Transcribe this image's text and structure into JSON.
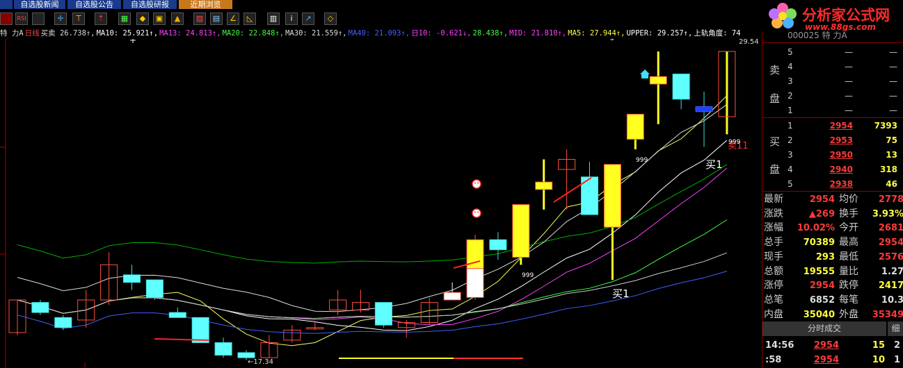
{
  "tabs": [
    "",
    "自选股新闻",
    "自选股公告",
    "自选股研报",
    "近期浏览"
  ],
  "indicator_bar": [
    {
      "text": "特  力A",
      "color": "#dddddd"
    },
    {
      "text": "日线",
      "color": "#ff4040"
    },
    {
      "text": "买卖 26.738↑,",
      "color": "#dddddd"
    },
    {
      "text": "MA10: 25.921↑,",
      "color": "#ffffff"
    },
    {
      "text": "MA13: 24.813↑,",
      "color": "#ff40ff"
    },
    {
      "text": "MA20: 22.848↑,",
      "color": "#40ff40"
    },
    {
      "text": "MA30: 21.559↑,",
      "color": "#dddddd"
    },
    {
      "text": "MA40: 21.093↑,",
      "color": "#4060ff"
    },
    {
      "text": "日10: -0.621↓,",
      "color": "#ff40ff"
    },
    {
      "text": "28.438↑,",
      "color": "#40ff40"
    },
    {
      "text": "MID: 21.810↑,",
      "color": "#ff40ff"
    },
    {
      "text": "MA5: 27.944↑,",
      "color": "#ffff40"
    },
    {
      "text": "UPPER: 29.257↑,",
      "color": "#ffffff"
    },
    {
      "text": "上轨角度: 74",
      "color": "#ffffff"
    }
  ],
  "chart_labels": {
    "top_right_price": "29.54",
    "low_price": "17.34",
    "buy1_a": "买1",
    "buy1_b": "买1",
    "sell11": "卖11",
    "n999_a": "999",
    "n999_b": "999",
    "n999_c": "999"
  },
  "logo": {
    "text": "分析家公式网",
    "url": "www.88gs.com"
  },
  "stock_code": "000025 特   力A",
  "sell_side_label": [
    "卖",
    "盘"
  ],
  "buy_side_label": [
    "买",
    "盘"
  ],
  "sell_orders": [
    {
      "level": "5",
      "price": "—",
      "volume": "—"
    },
    {
      "level": "4",
      "price": "—",
      "volume": "—"
    },
    {
      "level": "3",
      "price": "—",
      "volume": "—"
    },
    {
      "level": "2",
      "price": "—",
      "volume": "—"
    },
    {
      "level": "1",
      "price": "—",
      "volume": "—"
    }
  ],
  "buy_orders": [
    {
      "level": "1",
      "price": "2954",
      "volume": "7393"
    },
    {
      "level": "2",
      "price": "2953",
      "volume": "75"
    },
    {
      "level": "3",
      "price": "2950",
      "volume": "13"
    },
    {
      "level": "4",
      "price": "2940",
      "volume": "318"
    },
    {
      "level": "5",
      "price": "2938",
      "volume": "46"
    }
  ],
  "stats": [
    {
      "l1": "最新",
      "v1": "2954",
      "c1": "r",
      "l2": "均价",
      "v2": "2778",
      "c2": "r"
    },
    {
      "l1": "涨跌",
      "v1": "▲269",
      "c1": "r",
      "l2": "换手",
      "v2": "3.93%",
      "c2": "y"
    },
    {
      "l1": "涨幅",
      "v1": "10.02%",
      "c1": "r",
      "l2": "今开",
      "v2": "2681",
      "c2": "r"
    },
    {
      "l1": "总手",
      "v1": "70389",
      "c1": "y",
      "l2": "最高",
      "v2": "2954",
      "c2": "r"
    },
    {
      "l1": "现手",
      "v1": "293",
      "c1": "y",
      "l2": "最低",
      "v2": "2576",
      "c2": "r"
    },
    {
      "l1": "总额",
      "v1": "19555",
      "c1": "y",
      "l2": "量比",
      "v2": "1.27",
      "c2": "w"
    },
    {
      "l1": "涨停",
      "v1": "2954",
      "c1": "r",
      "l2": "跌停",
      "v2": "2417",
      "c2": "y"
    },
    {
      "l1": "总笔",
      "v1": "6852",
      "c1": "w",
      "l2": "每笔",
      "v2": "10.3",
      "c2": "w"
    },
    {
      "l1": "内盘",
      "v1": "35040",
      "c1": "y",
      "l2": "外盘",
      "v2": "35349",
      "c2": "r"
    }
  ],
  "tick_tab": "分时成交",
  "tick_tab2": "细",
  "ticks": [
    {
      "time": "14:56",
      "price": "2954",
      "vol": "15",
      "n": "2"
    },
    {
      "time": ":58",
      "price": "2954",
      "vol": "10",
      "n": "1"
    }
  ],
  "chart_data": {
    "type": "candlestick",
    "y_axis_price_range": [
      17.0,
      30.0
    ],
    "candles": [
      {
        "o": 18.3,
        "c": 19.6,
        "h": 19.6,
        "l": 18.2,
        "kind": "hollow"
      },
      {
        "o": 19.5,
        "c": 19.1,
        "h": 19.6,
        "l": 19.0,
        "kind": "cyan"
      },
      {
        "o": 18.9,
        "c": 18.5,
        "h": 19.0,
        "l": 18.4,
        "kind": "cyan"
      },
      {
        "o": 18.8,
        "c": 19.6,
        "h": 20.0,
        "l": 18.5,
        "kind": "hollow"
      },
      {
        "o": 19.6,
        "c": 21.0,
        "h": 21.5,
        "l": 19.4,
        "kind": "hollow"
      },
      {
        "o": 20.6,
        "c": 20.3,
        "h": 21.0,
        "l": 20.0,
        "kind": "cyan"
      },
      {
        "o": 20.4,
        "c": 19.7,
        "h": 20.4,
        "l": 19.6,
        "kind": "cyan"
      },
      {
        "o": 19.1,
        "c": 18.9,
        "h": 19.3,
        "l": 18.9,
        "kind": "cyan"
      },
      {
        "o": 18.9,
        "c": 17.9,
        "h": 18.9,
        "l": 17.9,
        "kind": "cyan"
      },
      {
        "o": 17.9,
        "c": 17.4,
        "h": 18.1,
        "l": 17.3,
        "kind": "cyan"
      },
      {
        "o": 17.5,
        "c": 17.3,
        "h": 17.6,
        "l": 17.2,
        "kind": "cyan"
      },
      {
        "o": 17.3,
        "c": 17.9,
        "h": 18.2,
        "l": 17.3,
        "kind": "hollow"
      },
      {
        "o": 18.0,
        "c": 18.4,
        "h": 18.6,
        "l": 17.9,
        "kind": "hollow"
      },
      {
        "o": 18.5,
        "c": 18.5,
        "h": 18.7,
        "l": 18.4,
        "kind": "hollow"
      },
      {
        "o": 19.2,
        "c": 19.6,
        "h": 20.0,
        "l": 19.0,
        "kind": "hollow"
      },
      {
        "o": 19.2,
        "c": 19.5,
        "h": 20.0,
        "l": 19.1,
        "kind": "hollow"
      },
      {
        "o": 19.5,
        "c": 18.6,
        "h": 19.5,
        "l": 18.5,
        "kind": "cyan"
      },
      {
        "o": 18.5,
        "c": 18.7,
        "h": 18.8,
        "l": 18.1,
        "kind": "hollow"
      },
      {
        "o": 18.7,
        "c": 19.5,
        "h": 19.7,
        "l": 18.6,
        "kind": "hollow"
      },
      {
        "o": 19.6,
        "c": 19.9,
        "h": 20.3,
        "l": 19.6,
        "kind": "white"
      },
      {
        "o": 19.7,
        "c": 22.0,
        "h": 22.2,
        "l": 19.6,
        "kind": "white_yellow"
      },
      {
        "o": 22.0,
        "c": 21.6,
        "h": 22.3,
        "l": 21.2,
        "kind": "cyan"
      },
      {
        "o": 21.3,
        "c": 23.4,
        "h": 23.4,
        "l": 21.0,
        "kind": "yellow"
      },
      {
        "o": 24.0,
        "c": 24.3,
        "h": 25.2,
        "l": 23.2,
        "kind": "yellow"
      },
      {
        "o": 24.8,
        "c": 25.2,
        "h": 25.6,
        "l": 23.2,
        "kind": "hollow"
      },
      {
        "o": 24.5,
        "c": 23.0,
        "h": 25.1,
        "l": 23.0,
        "kind": "cyan"
      },
      {
        "o": 22.5,
        "c": 25.0,
        "h": 25.0,
        "l": 20.4,
        "kind": "yellow_tall"
      },
      {
        "o": 27.0,
        "c": 26.0,
        "h": 27.0,
        "l": 25.6,
        "kind": "yellow"
      },
      {
        "o": 28.2,
        "c": 28.5,
        "h": 29.5,
        "l": 26.6,
        "kind": "yellow"
      },
      {
        "o": 28.6,
        "c": 27.6,
        "h": 28.6,
        "l": 27.2,
        "kind": "cyan"
      },
      {
        "o": 27.3,
        "c": 27.1,
        "h": 27.9,
        "l": 25.7,
        "kind": "blue"
      },
      {
        "o": 26.9,
        "c": 29.5,
        "h": 29.5,
        "l": 26.2,
        "kind": "hollow_yellow"
      }
    ]
  }
}
